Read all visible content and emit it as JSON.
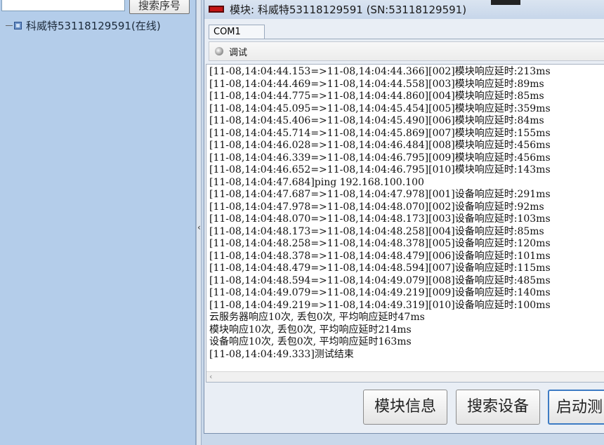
{
  "left_panel": {
    "search_placeholder": "",
    "search_button_label": "搜索序号",
    "tree_node_label": "科威特53118129591(在线)"
  },
  "splitter": {
    "grip": "‹"
  },
  "dialog": {
    "title": "模块: 科威特53118129591 (SN:53118129591)",
    "tab_label": "COM1",
    "panel_label": "调试",
    "log_lines": [
      "[11-08,14:04:44.153=>11-08,14:04:44.366][002]模块响应延时:213ms",
      "[11-08,14:04:44.469=>11-08,14:04:44.558][003]模块响应延时:89ms",
      "[11-08,14:04:44.775=>11-08,14:04:44.860][004]模块响应延时:85ms",
      "[11-08,14:04:45.095=>11-08,14:04:45.454][005]模块响应延时:359ms",
      "[11-08,14:04:45.406=>11-08,14:04:45.490][006]模块响应延时:84ms",
      "[11-08,14:04:45.714=>11-08,14:04:45.869][007]模块响应延时:155ms",
      "[11-08,14:04:46.028=>11-08,14:04:46.484][008]模块响应延时:456ms",
      "[11-08,14:04:46.339=>11-08,14:04:46.795][009]模块响应延时:456ms",
      "[11-08,14:04:46.652=>11-08,14:04:46.795][010]模块响应延时:143ms",
      "[11-08,14:04:47.684]ping 192.168.100.100",
      "[11-08,14:04:47.687=>11-08,14:04:47.978][001]设备响应延时:291ms",
      "[11-08,14:04:47.978=>11-08,14:04:48.070][002]设备响应延时:92ms",
      "[11-08,14:04:48.070=>11-08,14:04:48.173][003]设备响应延时:103ms",
      "[11-08,14:04:48.173=>11-08,14:04:48.258][004]设备响应延时:85ms",
      "[11-08,14:04:48.258=>11-08,14:04:48.378][005]设备响应延时:120ms",
      "[11-08,14:04:48.378=>11-08,14:04:48.479][006]设备响应延时:101ms",
      "[11-08,14:04:48.479=>11-08,14:04:48.594][007]设备响应延时:115ms",
      "[11-08,14:04:48.594=>11-08,14:04:49.079][008]设备响应延时:485ms",
      "[11-08,14:04:49.079=>11-08,14:04:49.219][009]设备响应延时:140ms",
      "[11-08,14:04:49.219=>11-08,14:04:49.319][010]设备响应延时:100ms",
      "云服务器响应10次, 丢包0次, 平均响应延时47ms",
      "模块响应10次, 丢包0次, 平均响应延时214ms",
      "设备响应10次, 丢包0次, 平均响应延时163ms",
      "[11-08,14:04:49.333]测试结束"
    ],
    "scroll_left_arrow": "‹",
    "buttons": {
      "module_info": "模块信息",
      "search_device": "搜索设备",
      "start_test": "启动测"
    }
  },
  "colors": {
    "left_panel_bg": "#b4cdea",
    "title_icon": "#c41414",
    "focused_button_border": "#3d7bc4"
  },
  "icons": {
    "title": "red-device-icon",
    "panel": "debug-orb-icon",
    "tree": "device-icon"
  }
}
